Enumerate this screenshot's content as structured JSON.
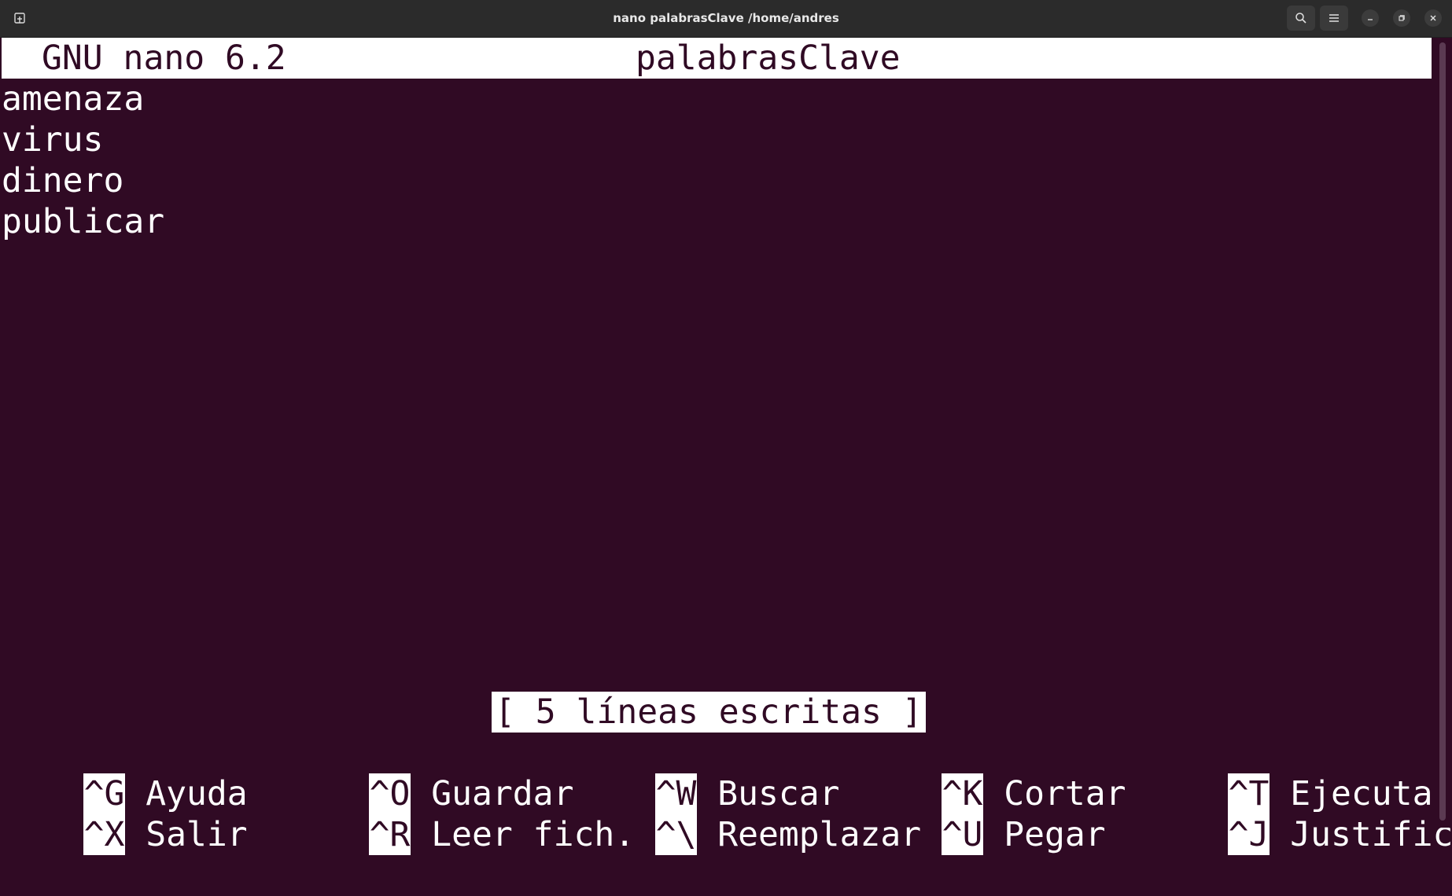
{
  "window": {
    "title": "nano palabrasClave /home/andres",
    "icons": {
      "new_tab": "new-tab-icon",
      "search": "search-icon",
      "menu": "hamburger-menu-icon",
      "minimize": "minimize-icon",
      "maximize": "restore-icon",
      "close": "close-icon"
    }
  },
  "nano": {
    "version": "GNU nano 6.2",
    "filename": "palabrasClave",
    "lines": [
      "amenaza",
      "virus",
      "dinero",
      "publicar"
    ],
    "status": "[ 5 líneas escritas ]",
    "shortcuts_row1": [
      {
        "key": "^G",
        "label": "Ayuda"
      },
      {
        "key": "^O",
        "label": "Guardar"
      },
      {
        "key": "^W",
        "label": "Buscar"
      },
      {
        "key": "^K",
        "label": "Cortar"
      },
      {
        "key": "^T",
        "label": "Ejecutar"
      }
    ],
    "shortcuts_row2": [
      {
        "key": "^X",
        "label": "Salir"
      },
      {
        "key": "^R",
        "label": "Leer fich."
      },
      {
        "key": "^\\",
        "label": "Reemplazar"
      },
      {
        "key": "^U",
        "label": "Pegar"
      },
      {
        "key": "^J",
        "label": "Justificar"
      }
    ]
  },
  "colors": {
    "terminal_bg": "#300a24",
    "text": "#ffffff",
    "titlebar_bg": "#2b2b2b"
  }
}
